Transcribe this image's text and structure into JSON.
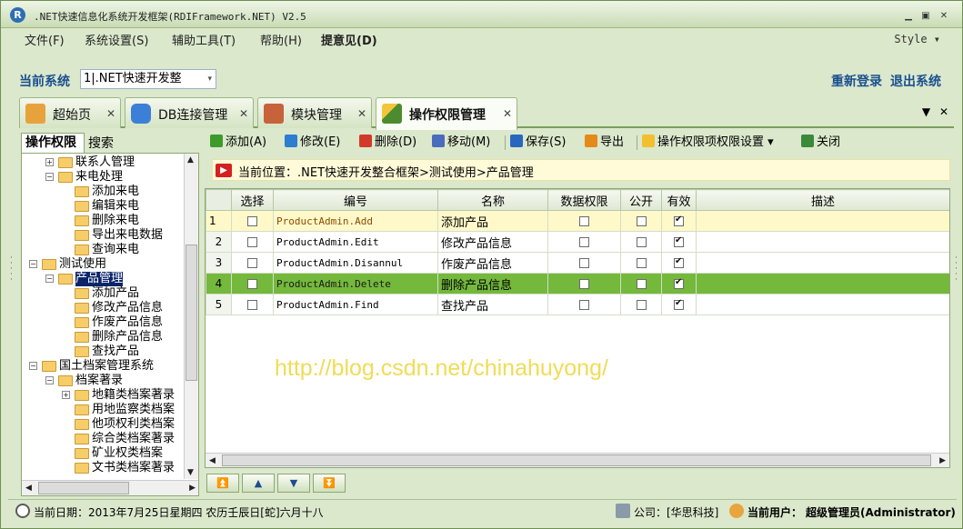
{
  "window": {
    "title": ".NET快速信息化系统开发框架(RDIFramework.NET) V2.5",
    "logo_letter": "R",
    "minimize": "▁",
    "restore": "▣",
    "close": "✕"
  },
  "menu": {
    "items": [
      "文件(F)",
      "系统设置(S)",
      "辅助工具(T)",
      "帮助(H)",
      "提意见(D)"
    ],
    "style_label": "Style ▾"
  },
  "system": {
    "label": "当前系统",
    "value": "1|.NET快速开发整",
    "relogin": "重新登录",
    "logout": "退出系统"
  },
  "tabs": [
    {
      "label": "超始页",
      "icon": "home-icon",
      "color": "#e0902c"
    },
    {
      "label": "DB连接管理",
      "icon": "database-icon",
      "color": "#3c7fd6"
    },
    {
      "label": "模块管理",
      "icon": "module-icon",
      "color": "#c6633a"
    },
    {
      "label": "操作权限管理",
      "icon": "pencil-icon",
      "color": "#4d8c2e",
      "active": true
    }
  ],
  "tab_tools": {
    "dropdown": "▼",
    "close": "✕"
  },
  "left_tabs": {
    "perm": "操作权限",
    "search": "搜索"
  },
  "tree": [
    {
      "label": "联系人管理",
      "level": 2,
      "expander": "+"
    },
    {
      "label": "来电处理",
      "level": 2,
      "expander": "−"
    },
    {
      "label": "添加来电",
      "level": 3
    },
    {
      "label": "编辑来电",
      "level": 3
    },
    {
      "label": "删除来电",
      "level": 3
    },
    {
      "label": "导出来电数据",
      "level": 3
    },
    {
      "label": "查询来电",
      "level": 3
    },
    {
      "label": "测试使用",
      "level": 1,
      "expander": "−"
    },
    {
      "label": "产品管理",
      "level": 2,
      "expander": "−",
      "selected": true
    },
    {
      "label": "添加产品",
      "level": 3
    },
    {
      "label": "修改产品信息",
      "level": 3
    },
    {
      "label": "作废产品信息",
      "level": 3
    },
    {
      "label": "删除产品信息",
      "level": 3
    },
    {
      "label": "查找产品",
      "level": 3
    },
    {
      "label": "国土档案管理系统",
      "level": 1,
      "expander": "−"
    },
    {
      "label": "档案著录",
      "level": 2,
      "expander": "−"
    },
    {
      "label": "地籍类档案著录",
      "level": 3,
      "expander": "+"
    },
    {
      "label": "用地监察类档案",
      "level": 3
    },
    {
      "label": "他项权利类档案",
      "level": 3
    },
    {
      "label": "综合类档案著录",
      "level": 3
    },
    {
      "label": "矿业权类档案",
      "level": 3
    },
    {
      "label": "文书类档案著录",
      "level": 3
    }
  ],
  "toolbar": [
    "添加(A)",
    "修改(E)",
    "删除(D)",
    "移动(M)",
    "保存(S)",
    "导出",
    "操作权限项权限设置 ▾",
    "关闭"
  ],
  "toolbar_icon_colors": [
    "#3f9a2c",
    "#2e7dd0",
    "#d13a2a",
    "#4a6cbf",
    "#2a66c0",
    "#e38a1a",
    "#f2c02e",
    "#3a8a3a"
  ],
  "location": {
    "arrow": "▶",
    "text": "当前位置：.NET快速开发整合框架>测试使用>产品管理"
  },
  "grid": {
    "columns": [
      "",
      "选择",
      "编号",
      "名称",
      "数据权限",
      "公开",
      "有效",
      "描述"
    ],
    "rows": [
      {
        "n": "1",
        "code": "ProductAdmin.Add",
        "name": "添加产品",
        "data": false,
        "pub": false,
        "valid": true,
        "state": "cur"
      },
      {
        "n": "2",
        "code": "ProductAdmin.Edit",
        "name": "修改产品信息",
        "data": false,
        "pub": false,
        "valid": true,
        "state": ""
      },
      {
        "n": "3",
        "code": "ProductAdmin.Disannul",
        "name": "作废产品信息",
        "data": false,
        "pub": false,
        "valid": true,
        "state": ""
      },
      {
        "n": "4",
        "code": "ProductAdmin.Delete",
        "name": "删除产品信息",
        "data": false,
        "pub": false,
        "valid": true,
        "state": "sel"
      },
      {
        "n": "5",
        "code": "ProductAdmin.Find",
        "name": "查找产品",
        "data": false,
        "pub": false,
        "valid": true,
        "state": ""
      }
    ]
  },
  "watermark": "http://blog.csdn.net/chinahuyong/",
  "nav_buttons": [
    "⏫",
    "▲",
    "▼",
    "⏬"
  ],
  "status": {
    "date": "当前日期：2013年7月25日星期四 农历壬辰日[蛇]六月十八",
    "company": "公司：[华思科技]",
    "user_label": "当前用户：",
    "user": "超级管理员(Administrator)"
  }
}
